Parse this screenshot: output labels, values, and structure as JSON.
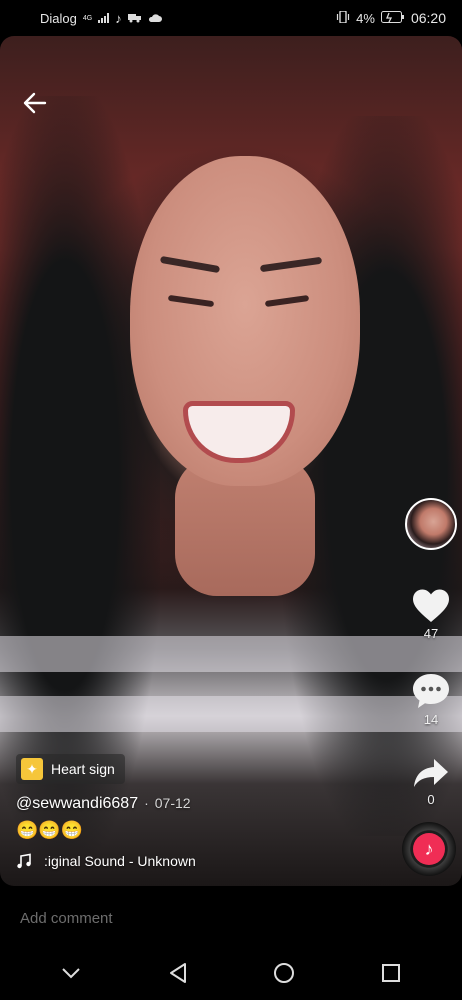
{
  "status": {
    "carrier": "Dialog",
    "network_label": "4G",
    "battery_percent": "4%",
    "time": "06:20"
  },
  "video": {
    "like_count": "47",
    "comment_count": "14",
    "share_count": "0",
    "effect_label": "Heart sign",
    "author": "@sewwandi6687",
    "date_separator": "·",
    "date": "07-12",
    "caption": "😁😁😁",
    "sound": ":iginal Sound - Unknown"
  },
  "comment_input": {
    "placeholder": "Add comment"
  },
  "icons": {
    "back": "back-arrow-icon",
    "like": "heart-icon",
    "comment": "comment-bubble-icon",
    "share": "share-arrow-icon",
    "music": "music-note-icon"
  },
  "colors": {
    "accent": "#f02d55",
    "effect_badge": "#f6c63a"
  }
}
